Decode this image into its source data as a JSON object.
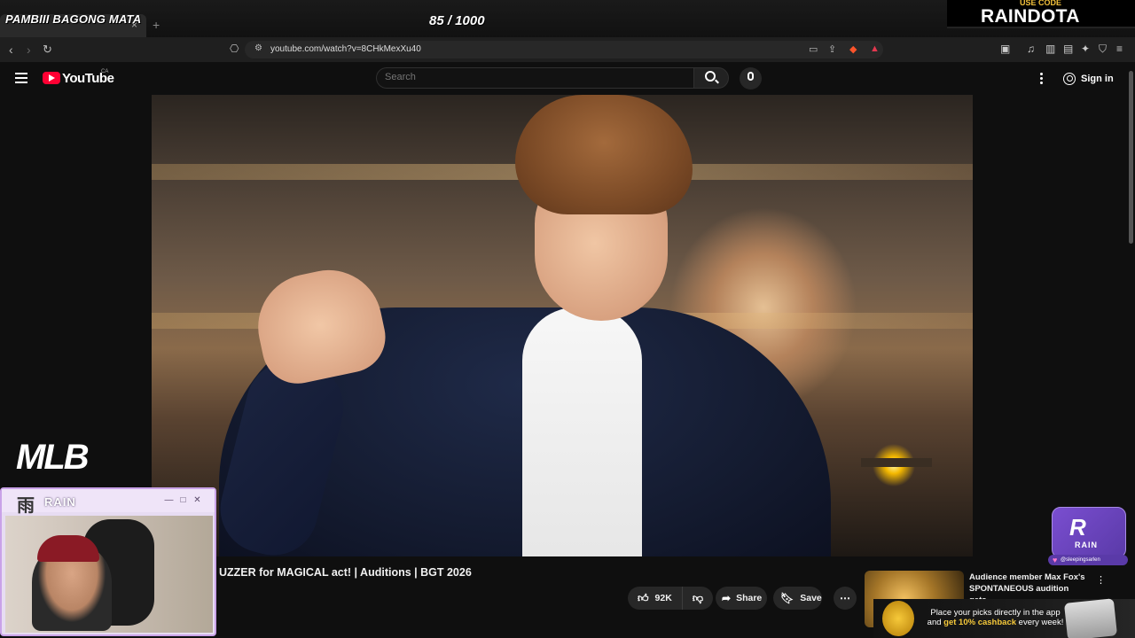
{
  "stream": {
    "title": "PAMBIII BAGONG MATA",
    "counter": "85 / 1000",
    "promo_label": "USE CODE",
    "promo_code": "RAINDOTA",
    "brand_left": "MLB",
    "webcam_title": "RAIN",
    "webcam_logo_glyph": "雨",
    "rain_logo_text": "RAIN",
    "rain_handle": "@sleepingsarlen"
  },
  "browser": {
    "url": "youtube.com/watch?v=8CHkMexXu40",
    "tab_close": "×",
    "tab_new": "+"
  },
  "youtube": {
    "logo_text": "YouTube",
    "region": "CA",
    "search_placeholder": "Search",
    "signin_label": "Sign in"
  },
  "video": {
    "title": "UZZER for MAGICAL act! | Auditions | BGT 2026",
    "likes": "92K",
    "share_label": "Share",
    "save_label": "Save"
  },
  "recommendation": {
    "title_line1": "Audience member Max Fox's",
    "title_line2": "SPONTANEOUS audition gets ..."
  },
  "ad": {
    "text_line1": "Place your picks directly in the app",
    "text_and": "and ",
    "text_highlight": "get 10% cashback",
    "text_end": " every week!"
  },
  "colors": {
    "youtube_red": "#ff0033",
    "accent_purple": "#7a4ed0",
    "promo_gold": "#f4c23c"
  }
}
